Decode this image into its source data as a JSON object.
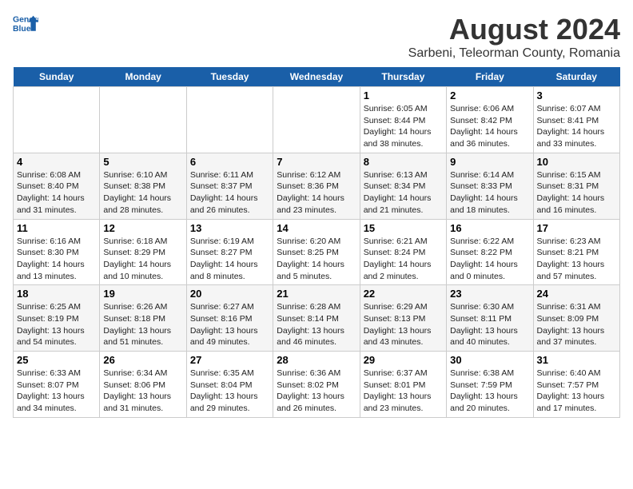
{
  "logo": {
    "line1": "General",
    "line2": "Blue"
  },
  "title": "August 2024",
  "subtitle": "Sarbeni, Teleorman County, Romania",
  "headers": [
    "Sunday",
    "Monday",
    "Tuesday",
    "Wednesday",
    "Thursday",
    "Friday",
    "Saturday"
  ],
  "weeks": [
    [
      {
        "day": "",
        "info": ""
      },
      {
        "day": "",
        "info": ""
      },
      {
        "day": "",
        "info": ""
      },
      {
        "day": "",
        "info": ""
      },
      {
        "day": "1",
        "info": "Sunrise: 6:05 AM\nSunset: 8:44 PM\nDaylight: 14 hours\nand 38 minutes."
      },
      {
        "day": "2",
        "info": "Sunrise: 6:06 AM\nSunset: 8:42 PM\nDaylight: 14 hours\nand 36 minutes."
      },
      {
        "day": "3",
        "info": "Sunrise: 6:07 AM\nSunset: 8:41 PM\nDaylight: 14 hours\nand 33 minutes."
      }
    ],
    [
      {
        "day": "4",
        "info": "Sunrise: 6:08 AM\nSunset: 8:40 PM\nDaylight: 14 hours\nand 31 minutes."
      },
      {
        "day": "5",
        "info": "Sunrise: 6:10 AM\nSunset: 8:38 PM\nDaylight: 14 hours\nand 28 minutes."
      },
      {
        "day": "6",
        "info": "Sunrise: 6:11 AM\nSunset: 8:37 PM\nDaylight: 14 hours\nand 26 minutes."
      },
      {
        "day": "7",
        "info": "Sunrise: 6:12 AM\nSunset: 8:36 PM\nDaylight: 14 hours\nand 23 minutes."
      },
      {
        "day": "8",
        "info": "Sunrise: 6:13 AM\nSunset: 8:34 PM\nDaylight: 14 hours\nand 21 minutes."
      },
      {
        "day": "9",
        "info": "Sunrise: 6:14 AM\nSunset: 8:33 PM\nDaylight: 14 hours\nand 18 minutes."
      },
      {
        "day": "10",
        "info": "Sunrise: 6:15 AM\nSunset: 8:31 PM\nDaylight: 14 hours\nand 16 minutes."
      }
    ],
    [
      {
        "day": "11",
        "info": "Sunrise: 6:16 AM\nSunset: 8:30 PM\nDaylight: 14 hours\nand 13 minutes."
      },
      {
        "day": "12",
        "info": "Sunrise: 6:18 AM\nSunset: 8:29 PM\nDaylight: 14 hours\nand 10 minutes."
      },
      {
        "day": "13",
        "info": "Sunrise: 6:19 AM\nSunset: 8:27 PM\nDaylight: 14 hours\nand 8 minutes."
      },
      {
        "day": "14",
        "info": "Sunrise: 6:20 AM\nSunset: 8:25 PM\nDaylight: 14 hours\nand 5 minutes."
      },
      {
        "day": "15",
        "info": "Sunrise: 6:21 AM\nSunset: 8:24 PM\nDaylight: 14 hours\nand 2 minutes."
      },
      {
        "day": "16",
        "info": "Sunrise: 6:22 AM\nSunset: 8:22 PM\nDaylight: 14 hours\nand 0 minutes."
      },
      {
        "day": "17",
        "info": "Sunrise: 6:23 AM\nSunset: 8:21 PM\nDaylight: 13 hours\nand 57 minutes."
      }
    ],
    [
      {
        "day": "18",
        "info": "Sunrise: 6:25 AM\nSunset: 8:19 PM\nDaylight: 13 hours\nand 54 minutes."
      },
      {
        "day": "19",
        "info": "Sunrise: 6:26 AM\nSunset: 8:18 PM\nDaylight: 13 hours\nand 51 minutes."
      },
      {
        "day": "20",
        "info": "Sunrise: 6:27 AM\nSunset: 8:16 PM\nDaylight: 13 hours\nand 49 minutes."
      },
      {
        "day": "21",
        "info": "Sunrise: 6:28 AM\nSunset: 8:14 PM\nDaylight: 13 hours\nand 46 minutes."
      },
      {
        "day": "22",
        "info": "Sunrise: 6:29 AM\nSunset: 8:13 PM\nDaylight: 13 hours\nand 43 minutes."
      },
      {
        "day": "23",
        "info": "Sunrise: 6:30 AM\nSunset: 8:11 PM\nDaylight: 13 hours\nand 40 minutes."
      },
      {
        "day": "24",
        "info": "Sunrise: 6:31 AM\nSunset: 8:09 PM\nDaylight: 13 hours\nand 37 minutes."
      }
    ],
    [
      {
        "day": "25",
        "info": "Sunrise: 6:33 AM\nSunset: 8:07 PM\nDaylight: 13 hours\nand 34 minutes."
      },
      {
        "day": "26",
        "info": "Sunrise: 6:34 AM\nSunset: 8:06 PM\nDaylight: 13 hours\nand 31 minutes."
      },
      {
        "day": "27",
        "info": "Sunrise: 6:35 AM\nSunset: 8:04 PM\nDaylight: 13 hours\nand 29 minutes."
      },
      {
        "day": "28",
        "info": "Sunrise: 6:36 AM\nSunset: 8:02 PM\nDaylight: 13 hours\nand 26 minutes."
      },
      {
        "day": "29",
        "info": "Sunrise: 6:37 AM\nSunset: 8:01 PM\nDaylight: 13 hours\nand 23 minutes."
      },
      {
        "day": "30",
        "info": "Sunrise: 6:38 AM\nSunset: 7:59 PM\nDaylight: 13 hours\nand 20 minutes."
      },
      {
        "day": "31",
        "info": "Sunrise: 6:40 AM\nSunset: 7:57 PM\nDaylight: 13 hours\nand 17 minutes."
      }
    ]
  ]
}
